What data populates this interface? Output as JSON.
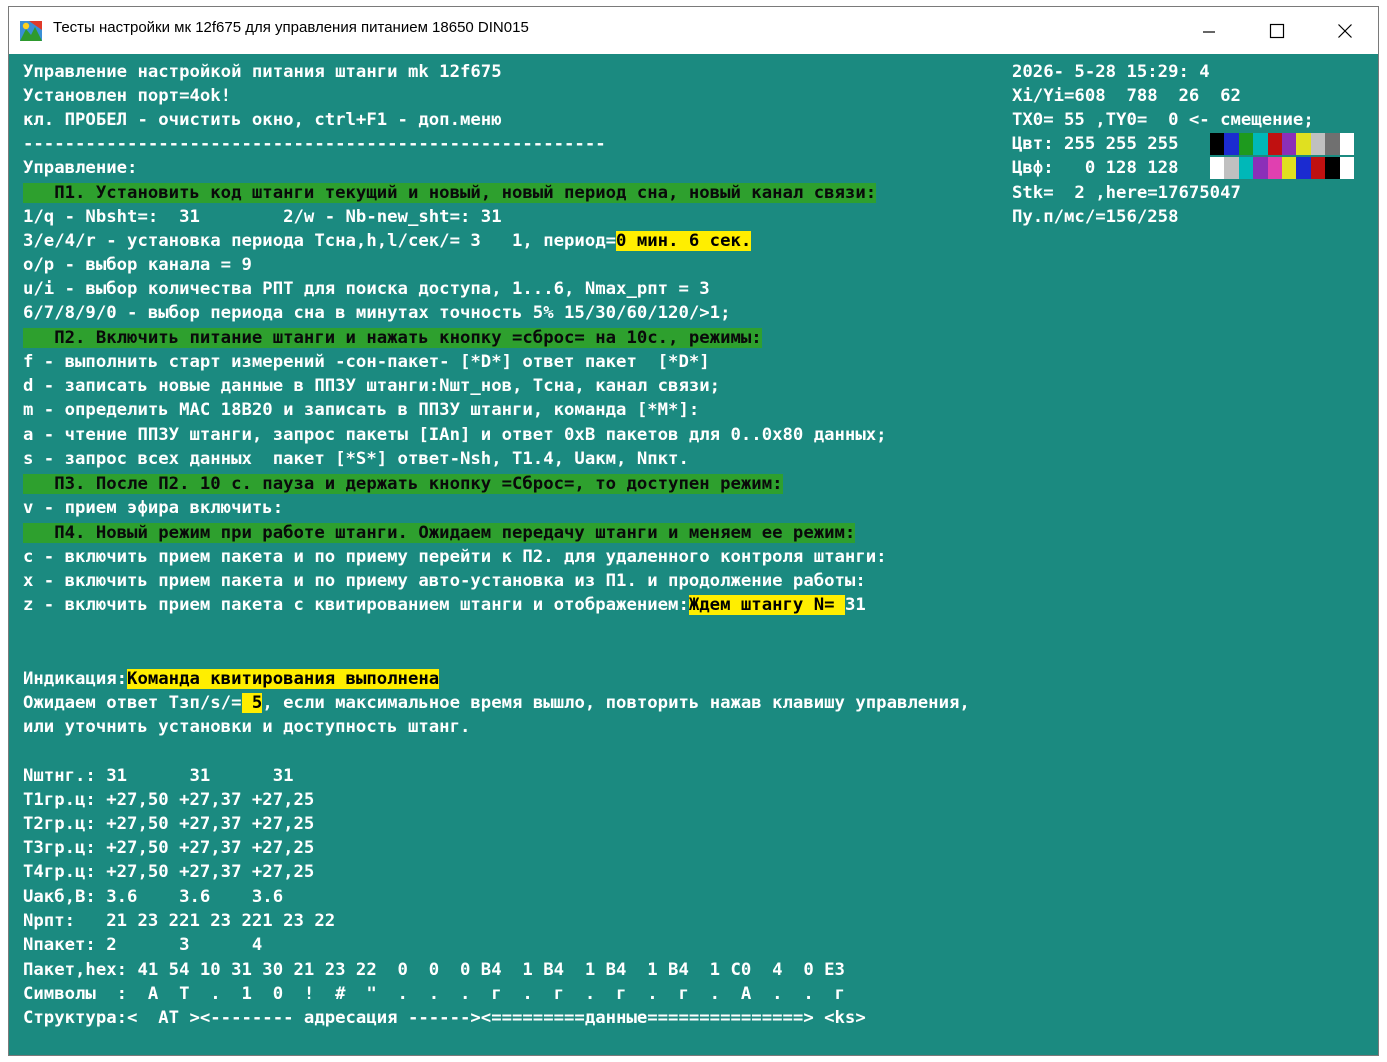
{
  "window": {
    "title": "Тесты настройки мк 12f675 для управления питанием 18650 DIN015",
    "icons": {
      "app": "app-icon",
      "minimize": "minimize-icon",
      "maximize": "maximize-icon",
      "close": "close-icon"
    }
  },
  "console": {
    "header": [
      "Управление настройкой питания штанги mk 12f675",
      "Установлен порт=4ok!",
      "кл. ПРОБЕЛ - очистить окно, ctrl+F1 - доп.меню",
      "--------------------------------------------------------",
      "Управление:"
    ],
    "p1": {
      "title": "   П1. Установить код штанги текущий и новый, новый период сна, новый канал связи:",
      "line1": "1/q - Nbsht=:  31        2/w - Nb-new_sht=: 31",
      "line2_prefix": "3/e/4/r - установка периода Tсна,h,l/сек/= 3   1, период=",
      "line2_highlight": "0 мин. 6 сек.",
      "line3": "o/p - выбор канала = 9",
      "line4": "u/i - выбор количества РПТ для поиска доступа, 1...6, Nmax_рпт = 3",
      "line5": "6/7/8/9/0 - выбор периода сна в минутах точность 5% 15/30/60/120/>1;"
    },
    "p2": {
      "title": "   П2. Включить питание штанги и нажать кнопку =сброс= на 10с., режимы:",
      "lines": [
        "f - выполнить старт измерений -сон-пакет- [*D*] ответ пакет  [*D*]",
        "d - записать новые данные в ПП3У штанги:Nшт_нов, Tсна, канал связи;",
        "m - определить MAC 18B20 и записать в ПП3У штанги, команда [*M*]:",
        "a - чтение ПП3У штанги, запрос пакеты [IAn] и ответ 0xB пакетов для 0..0x80 данных;",
        "s - запрос всех данных  пакет [*S*] ответ-Nsh, T1.4, Uакм, Nпкт."
      ]
    },
    "p3": {
      "title": "   П3. После П2. 10 с. пауза и держать кнопку =Сброс=, то доступен режим:",
      "lines": [
        "v - прием эфира включить:"
      ]
    },
    "p4": {
      "title": "   П4. Новый режим при работе штанги. Ожидаем передачу штанги и меняем ее режим:",
      "lines": [
        "c - включить прием пакета и по приему перейти к П2. для удаленного контроля штанги:",
        "x - включить прием пакета и по приему авто-установка из П1. и продолжение работы:"
      ],
      "z_prefix": "z - включить прием пакета с квитированием штанги и отображением:",
      "z_highlight": "Ждем штангу N= ",
      "z_value": "31"
    },
    "indication": {
      "label": "Индикация:",
      "value": "Команда квитирования выполнена",
      "wait_prefix": "Ожидаем ответ Tзп/s/=",
      "wait_value": " 5",
      "wait_suffix": ", если максимальное время вышло, повторить нажав клавишу управления,",
      "wait_line2": "или уточнить установки и доступность штанг."
    },
    "table": [
      "Nштнг.: 31      31      31",
      "T1гр.ц: +27,50 +27,37 +27,25",
      "T2гр.ц: +27,50 +27,37 +27,25",
      "T3гр.ц: +27,50 +27,37 +27,25",
      "T4гр.ц: +27,50 +27,37 +27,25",
      "Uакб,B: 3.6    3.6    3.6",
      "Nрпт:   21 23 221 23 221 23 22",
      "Nпакет: 2      3      4",
      "Пакет,hex: 41 54 10 31 30 21 23 22  0  0  0 B4  1 B4  1 B4  1 B4  1 C0  4  0 E3",
      "Символы  :  A  T  .  1  0  !  #  \"  .  .  .  г  .  г  .  г  .  г  .  A  .  .  г",
      "Структура:<  AT ><-------- адресация ------><=========данные===============> <ks>"
    ]
  },
  "status": {
    "datetime": "2026- 5-28 15:29: 4",
    "xy": "Xi/Yi=608  788  26  62",
    "offset": "TX0= 55 ,TY0=  0 <- смещение;",
    "cvt": "Цвт: 255 255 255",
    "cvf": "Цвф:   0 128 128",
    "stk": "Stk=  2 ,here=17675047",
    "pu": "Пу.п/мс/=156/258",
    "palette_fg": [
      "#000000",
      "#1b2bd0",
      "#1e9a1e",
      "#00b8b8",
      "#c01010",
      "#8b2fb8",
      "#e0e020",
      "#c0c0c0",
      "#707070",
      "#ffffff"
    ],
    "palette_bg": [
      "#ffffff",
      "#c0c0c0",
      "#00b8b8",
      "#8b2fb8",
      "#e040b0",
      "#e0e020",
      "#1b2bd0",
      "#c01010",
      "#000000",
      "#ffffff"
    ]
  }
}
